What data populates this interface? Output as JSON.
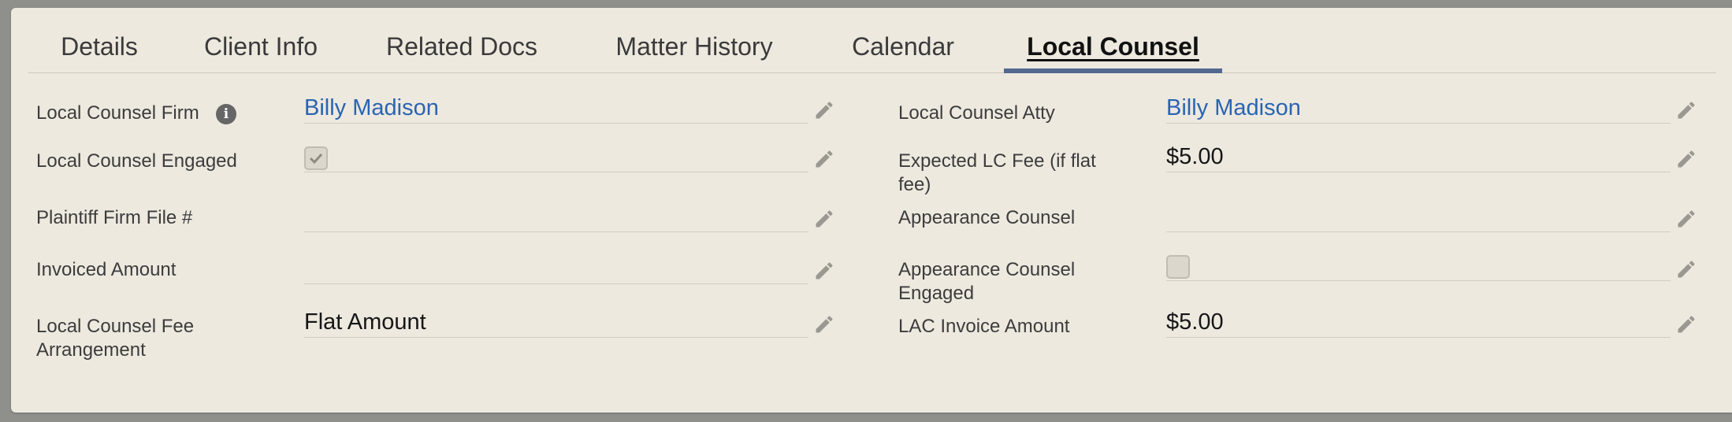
{
  "tabs": [
    {
      "label": "Details"
    },
    {
      "label": "Client Info"
    },
    {
      "label": "Related Docs"
    },
    {
      "label": "Matter History"
    },
    {
      "label": "Calendar"
    },
    {
      "label": "Local Counsel",
      "active": true
    }
  ],
  "left_fields": [
    {
      "label": "Local Counsel Firm",
      "value": "Billy Madison",
      "type": "link",
      "info_icon": true
    },
    {
      "label": "Local Counsel Engaged",
      "type": "checkbox",
      "checked": true
    },
    {
      "label": "Plaintiff Firm File #",
      "value": ""
    },
    {
      "label": "Invoiced Amount",
      "value": ""
    },
    {
      "label": "Local Counsel Fee Arrangement",
      "value": "Flat Amount"
    }
  ],
  "right_fields": [
    {
      "label": "Local Counsel Atty",
      "value": "Billy Madison",
      "type": "link"
    },
    {
      "label": "Expected LC Fee (if flat fee)",
      "value": "$5.00"
    },
    {
      "label": "Appearance Counsel",
      "value": ""
    },
    {
      "label": "Appearance Counsel Engaged",
      "type": "checkbox",
      "checked": false
    },
    {
      "label": "LAC Invoice Amount",
      "value": "$5.00"
    }
  ],
  "icons": {
    "edit": "pencil-icon",
    "info": "info-icon",
    "check": "checkmark-icon"
  },
  "colors": {
    "panel_bg": "#ede9df",
    "link": "#2a64b2",
    "active_tab_bar": "#53688e"
  }
}
